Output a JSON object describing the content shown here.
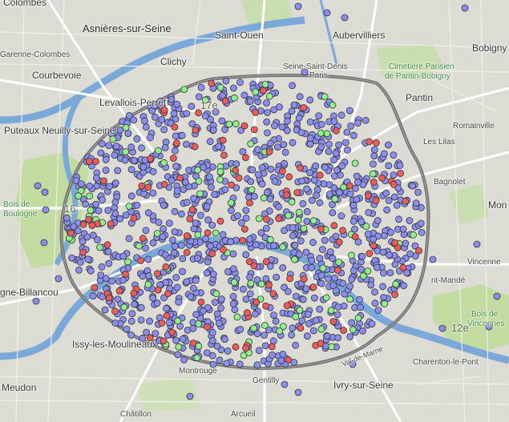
{
  "map": {
    "place_labels": [
      {
        "name": "colombes",
        "text": "Colombes"
      },
      {
        "name": "asnieres",
        "text": "Asnières-sur-Seine"
      },
      {
        "name": "saint-ouen",
        "text": "Saint-Ouen"
      },
      {
        "name": "aubervilliers",
        "text": "Aubervilliers"
      },
      {
        "name": "bobigny",
        "text": "Bobigny"
      },
      {
        "name": "garenne",
        "text": "Garenne-Colombes"
      },
      {
        "name": "clichy",
        "text": "Clichy"
      },
      {
        "name": "courbevoie",
        "text": "Courbevoie"
      },
      {
        "name": "levallois",
        "text": "Levallois-Perret"
      },
      {
        "name": "seine-saint-denis",
        "text": "Seine-Saint-Denis"
      },
      {
        "name": "paris-top",
        "text": "Paris"
      },
      {
        "name": "cimetiere",
        "text": "Cimetière Parisien"
      },
      {
        "name": "pantin-bobigny",
        "text": "de Pantin-Bobigny"
      },
      {
        "name": "pantin",
        "text": "Pantin"
      },
      {
        "name": "puteaux",
        "text": "Puteaux Neuilly-sur-Seine"
      },
      {
        "name": "romainville",
        "text": "Romainville"
      },
      {
        "name": "les-lilas",
        "text": "Les Lilas"
      },
      {
        "name": "bois-boulogne-1",
        "text": "Bois de"
      },
      {
        "name": "bois-boulogne-2",
        "text": "Boulogne"
      },
      {
        "name": "bagnolet",
        "text": "Bagnolet"
      },
      {
        "name": "montreuil",
        "text": "Mon"
      },
      {
        "name": "vincennes",
        "text": "Vincenne"
      },
      {
        "name": "billancourt",
        "text": "gne-Billancou"
      },
      {
        "name": "saint-mande",
        "text": "nt-Mandé"
      },
      {
        "name": "bois-vincennes-1",
        "text": "Bois de"
      },
      {
        "name": "bois-vincennes-2",
        "text": "Vincennes"
      },
      {
        "name": "issy",
        "text": "Issy-les-Moulineaux"
      },
      {
        "name": "val-de-marne",
        "text": "Val-de-Marne"
      },
      {
        "name": "charenton",
        "text": "Charenton-le-Pont"
      },
      {
        "name": "montrouge",
        "text": "Montrouge"
      },
      {
        "name": "gentilly",
        "text": "Gentilly"
      },
      {
        "name": "ivry",
        "text": "Ivry-sur-Seine"
      },
      {
        "name": "meudon",
        "text": "Meudon"
      },
      {
        "name": "chatillon",
        "text": "Châtillon"
      },
      {
        "name": "arcueil",
        "text": "Arcueil"
      }
    ],
    "arrondissement_labels": [
      {
        "name": "arr-17",
        "text": "17e"
      },
      {
        "name": "arr-16",
        "text": "16"
      },
      {
        "name": "arr-12",
        "text": "12e"
      }
    ],
    "legend_colors": {
      "blue_marker": "#8a8ef0",
      "red_marker": "#ef5a5a",
      "green_marker": "#8ef08a",
      "seine": "#7aa8d8",
      "park": "#c2dba0",
      "land": "#dcdcd4",
      "major_road": "#ffffff",
      "ring_road": "#6e6e6e"
    },
    "marker_counts": {
      "blue": 1100,
      "red": 130,
      "green": 110
    }
  }
}
